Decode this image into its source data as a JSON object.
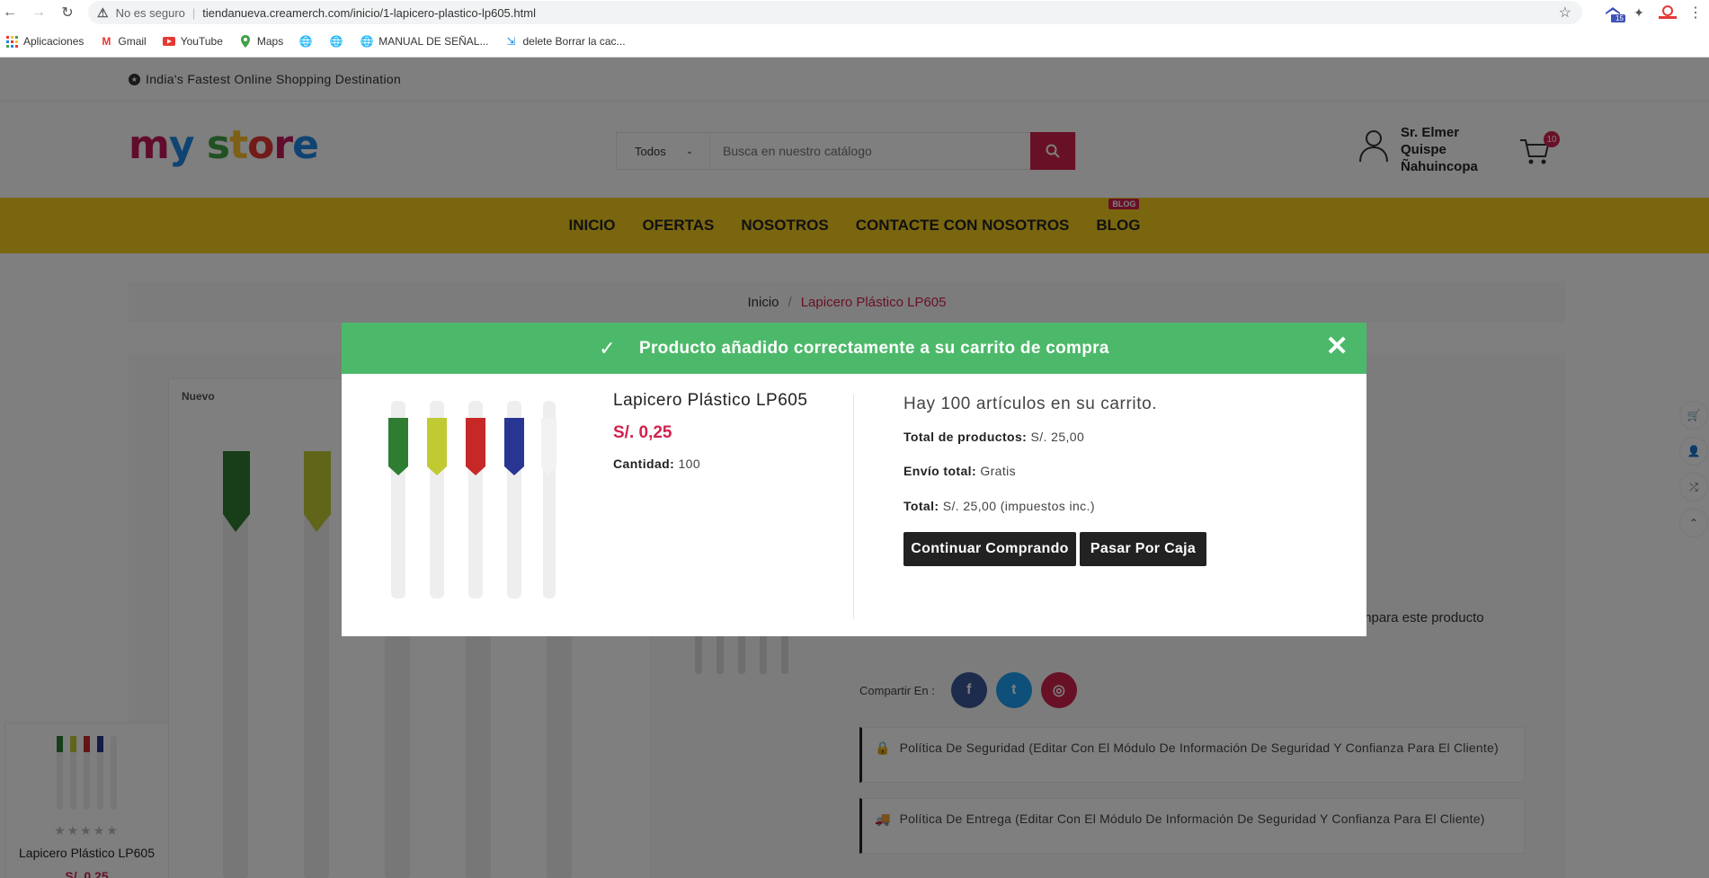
{
  "browser": {
    "security_label": "No es seguro",
    "url": "tiendanueva.creamerch.com/inicio/1-lapicero-plastico-lp605.html",
    "extension_badge": "15",
    "bookmarks": [
      {
        "label": "Aplicaciones",
        "icon": "apps-grid-icon"
      },
      {
        "label": "Gmail",
        "icon": "gmail-icon"
      },
      {
        "label": "YouTube",
        "icon": "youtube-icon"
      },
      {
        "label": "Maps",
        "icon": "maps-pin-icon"
      },
      {
        "label": "",
        "icon": "globe-icon"
      },
      {
        "label": "",
        "icon": "globe-icon"
      },
      {
        "label": "MANUAL DE SEÑAL...",
        "icon": "globe-icon"
      },
      {
        "label": "delete Borrar la cac...",
        "icon": "link-icon"
      }
    ]
  },
  "store": {
    "tagline": "India's Fastest Online Shopping Destination",
    "logo_text": "my store",
    "search": {
      "category": "Todos",
      "placeholder": "Busca en nuestro catálogo"
    },
    "user_name_line1": "Sr. Elmer",
    "user_name_line2": "Quispe",
    "user_name_line3": "Ñahuincopa",
    "cart_count": "10",
    "menu": {
      "inicio": "INICIO",
      "ofertas": "OFERTAS",
      "nosotros": "NOSOTROS",
      "contacte": "CONTACTE CON NOSOTROS",
      "blog": "BLOG",
      "blog_tag": "BLOG"
    },
    "breadcrumb": {
      "home": "Inicio",
      "current": "Lapicero Plástico LP605"
    },
    "product": {
      "badge": "Nuevo",
      "compare_text": "mpara este producto",
      "share_label": "Compartir En :",
      "policy_security": "Política De Seguridad (Editar Con El Módulo De Información De Seguridad Y Confianza Para El Cliente)",
      "policy_delivery": "Política De Entrega (Editar Con El Módulo De Información De Seguridad Y Confianza Para El Cliente)"
    },
    "mini_card": {
      "name": "Lapicero Plástico LP605",
      "price": "S/. 0,25",
      "rating": 0
    },
    "colors": {
      "accent": "#d0224d",
      "menu_bar": "#f5cc1f",
      "success": "#4cb96a"
    }
  },
  "modal": {
    "title": "Producto añadido correctamente a su carrito de compra",
    "product_name": "Lapicero Plástico LP605",
    "price": "S/. 0,25",
    "qty_label": "Cantidad:",
    "qty_value": "100",
    "cart_count_text": "Hay 100 artículos en su carrito.",
    "total_products_label": "Total de productos:",
    "total_products_value": "S/. 25,00",
    "shipping_label": "Envío total:",
    "shipping_value": "Gratis",
    "total_label": "Total:",
    "total_value": "S/. 25,00 (impuestos inc.)",
    "continue_button": "Continuar Comprando",
    "checkout_button": "Pasar Por Caja"
  }
}
